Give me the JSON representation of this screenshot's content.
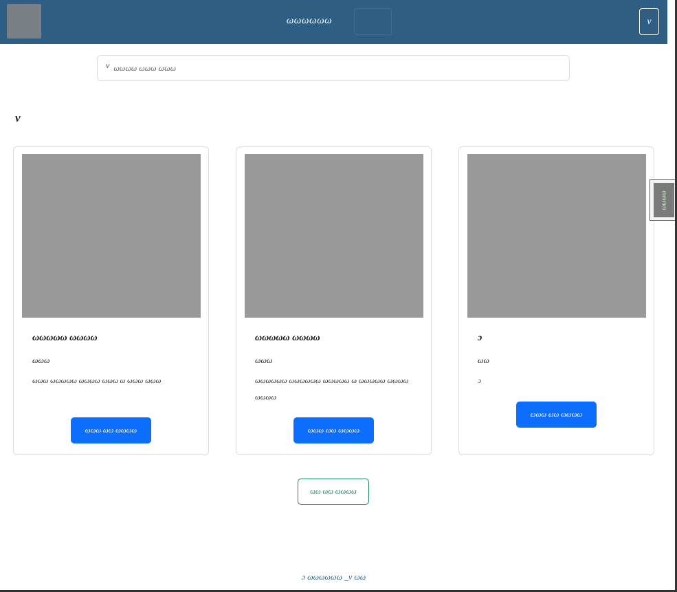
{
  "header": {
    "title": "ωωωωωω",
    "menu_label": "ν"
  },
  "search": {
    "icon_glyph": "ν",
    "placeholder": "ωωωω ωωω ωωω"
  },
  "section": {
    "label": "ν"
  },
  "products": [
    {
      "title": "ωωωωω ωωωω",
      "price": "ωωω",
      "description": "ωωω ωωωωω ωωωω ωωω ω ωωω ωωω",
      "button_label": "ωωω ωω ωωωω"
    },
    {
      "title": "ωωωωω ωωωω",
      "price": "ωωω",
      "description": "ωωωωωω ωωωωωω ωωωωω ω ωωωωω ωωωω ωωωω",
      "button_label": "ωωω ωω ωωωω"
    },
    {
      "title": "ɔ",
      "price": "ωω",
      "description": "ɔ",
      "button_label": "ωωω ωω ωωωω"
    }
  ],
  "side_tab": {
    "label": "ωωωω"
  },
  "more_button": {
    "label": "ωω ωω ωωωω"
  },
  "footer": {
    "text": "ɔ ωωωωωω _ν ωω"
  },
  "colors": {
    "header_bg": "#2e5e84",
    "primary": "#0d6efd",
    "success": "#198754",
    "placeholder_gray": "#999999"
  }
}
